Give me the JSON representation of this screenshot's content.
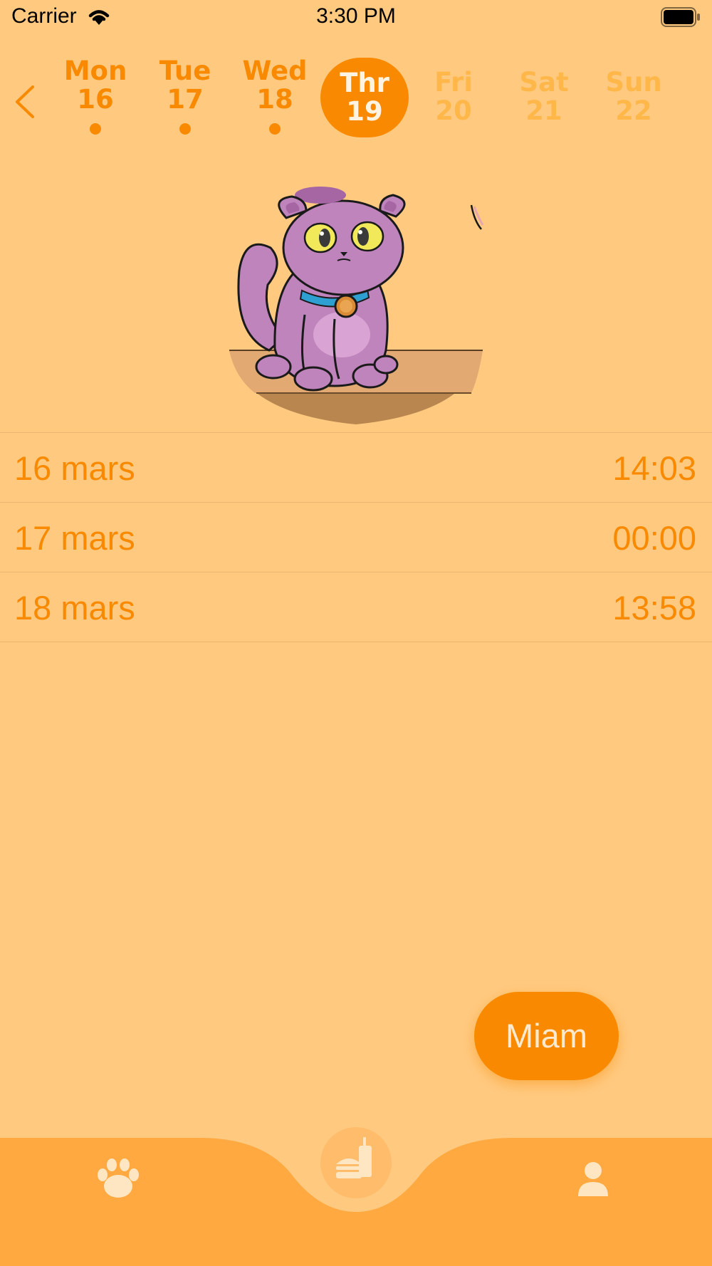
{
  "status_bar": {
    "carrier": "Carrier",
    "time": "3:30 PM"
  },
  "week": {
    "days": [
      {
        "name": "Mon",
        "num": "16",
        "state": "past"
      },
      {
        "name": "Tue",
        "num": "17",
        "state": "past"
      },
      {
        "name": "Wed",
        "num": "18",
        "state": "past"
      },
      {
        "name": "Thr",
        "num": "19",
        "state": "active"
      },
      {
        "name": "Fri",
        "num": "20",
        "state": "future"
      },
      {
        "name": "Sat",
        "num": "21",
        "state": "future"
      },
      {
        "name": "Sun",
        "num": "22",
        "state": "future"
      }
    ]
  },
  "meals": [
    {
      "date": "16 mars",
      "time": "14:03"
    },
    {
      "date": "17 mars",
      "time": "00:00"
    },
    {
      "date": "18 mars",
      "time": "13:58"
    }
  ],
  "action": {
    "label": "Miam"
  },
  "tabs": [
    {
      "icon": "paw-icon"
    },
    {
      "icon": "burger-drink-icon"
    },
    {
      "icon": "profile-icon"
    }
  ],
  "colors": {
    "background": "#FFCA80",
    "accent": "#F98A00",
    "tabbar": "#FFA940",
    "future_day": "#FFB74A"
  }
}
